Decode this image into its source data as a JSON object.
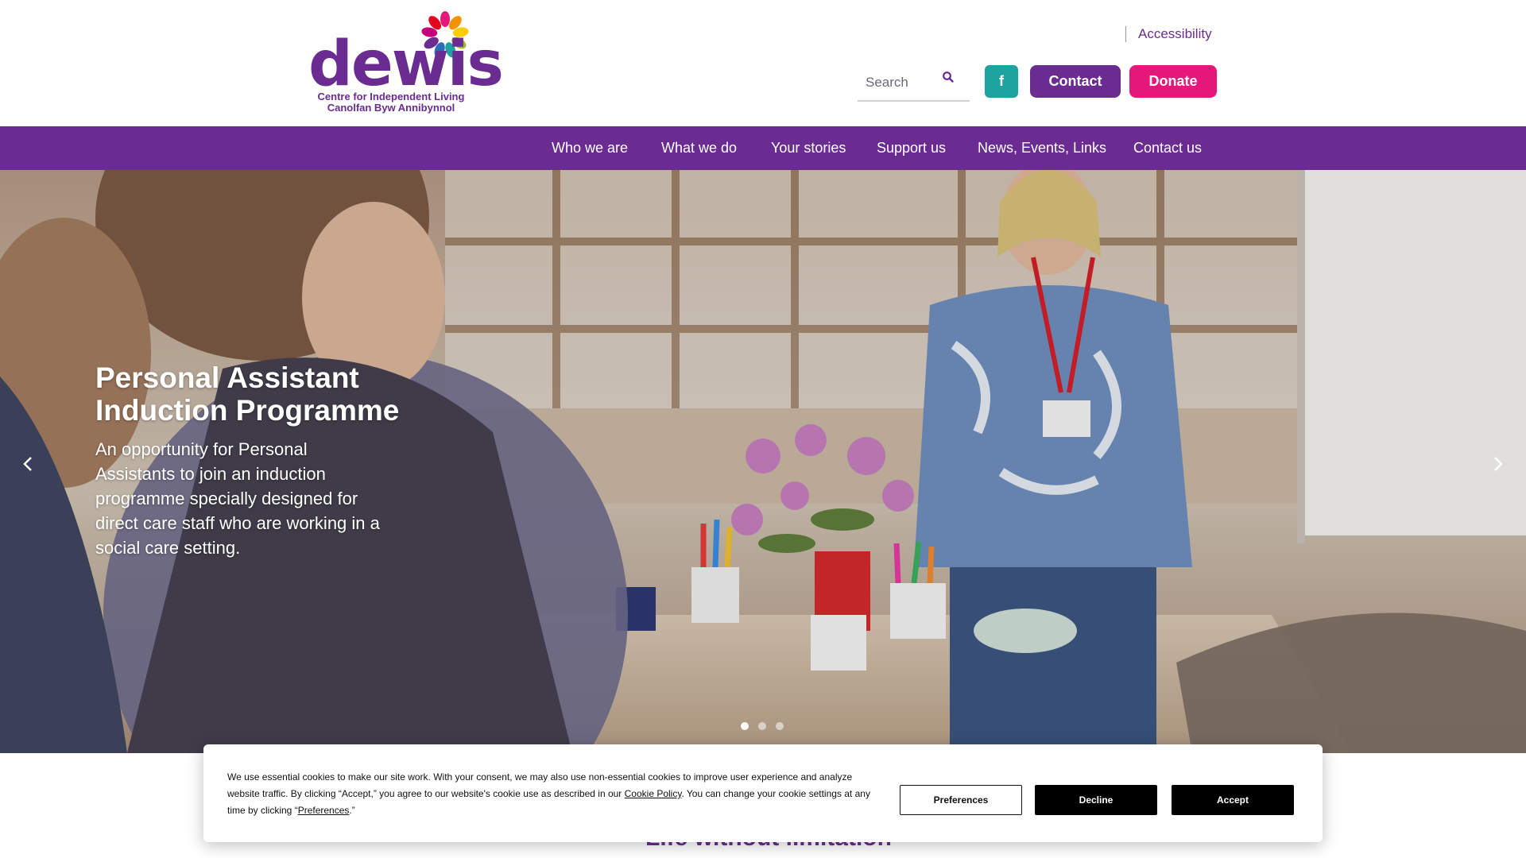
{
  "header": {
    "logo": {
      "wordmark": "dewis",
      "subtitle_line1": "Centre for Independent Living",
      "subtitle_line2": "Canolfan Byw Annibynnol"
    },
    "accessibility_label": "Accessibility",
    "search": {
      "placeholder": "Search",
      "icon": "search-icon"
    },
    "facebook_icon": "facebook-icon",
    "contact_label": "Contact",
    "donate_label": "Donate"
  },
  "nav": {
    "items": [
      {
        "label": "Who we are"
      },
      {
        "label": "What we do"
      },
      {
        "label": "Your stories"
      },
      {
        "label": "Support us"
      },
      {
        "label": "News, Events, Links"
      },
      {
        "label": "Contact us"
      }
    ]
  },
  "hero": {
    "title": "Personal Assistant Induction Programme",
    "text": "An opportunity for Personal Assistants to join an induction programme specially designed for direct care staff who are working in a social care setting.",
    "slides_total": 3,
    "active_slide": 1,
    "prev_icon": "chevron-left-icon",
    "next_icon": "chevron-right-icon"
  },
  "tagline_partial": "Life without limitation",
  "cookie_banner": {
    "text_before_policy": "We use essential cookies to make our site work. With your consent, we may also use non-essential cookies to improve user experience and analyze website traffic. By clicking “Accept,” you agree to our website's cookie use as described in our ",
    "policy_link": "Cookie Policy",
    "text_middle": ". You can change your cookie settings at any time by clicking “",
    "preferences_link": "Preferences",
    "text_end": ".”",
    "preferences_label": "Preferences",
    "decline_label": "Decline",
    "accept_label": "Accept"
  },
  "colors": {
    "brand_purple": "#6a2c91",
    "donate_pink": "#e6177a",
    "facebook_teal": "#1ea3a0"
  }
}
